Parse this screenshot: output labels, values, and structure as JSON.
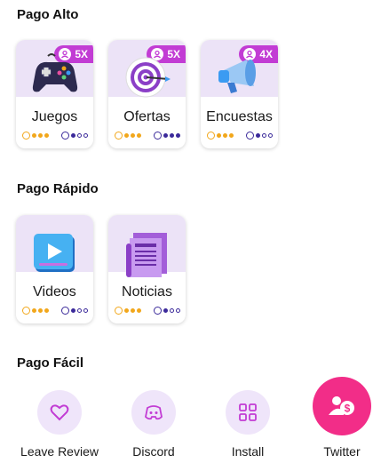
{
  "sections": {
    "high": {
      "title": "Pago Alto",
      "cards": [
        {
          "label": "Juegos",
          "multiplier": "5X",
          "icon": "gamepad-icon",
          "pay_level": 3,
          "time_level": 1
        },
        {
          "label": "Ofertas",
          "multiplier": "5X",
          "icon": "target-icon",
          "pay_level": 3,
          "time_level": 3
        },
        {
          "label": "Encuestas",
          "multiplier": "4X",
          "icon": "megaphone-icon",
          "pay_level": 3,
          "time_level": 1
        }
      ]
    },
    "fast": {
      "title": "Pago Rápido",
      "cards": [
        {
          "label": "Videos",
          "icon": "video-play-icon",
          "pay_level": 3,
          "time_level": 1
        },
        {
          "label": "Noticias",
          "icon": "newspaper-icon",
          "pay_level": 3,
          "time_level": 1
        }
      ]
    },
    "easy": {
      "title": "Pago Fácil",
      "items": [
        {
          "label": "Leave Review",
          "icon": "heart-icon"
        },
        {
          "label": "Discord",
          "icon": "discord-icon"
        },
        {
          "label": "Install",
          "icon": "grid-icon"
        },
        {
          "label": "Twitter",
          "icon": "dollar-user-icon"
        }
      ]
    }
  },
  "colors": {
    "accent": "#c23cd4",
    "card_top": "#ece3f7",
    "coin": "#f2a71b",
    "time": "#3b2a9a",
    "twitter_bg": "#f22d88"
  }
}
